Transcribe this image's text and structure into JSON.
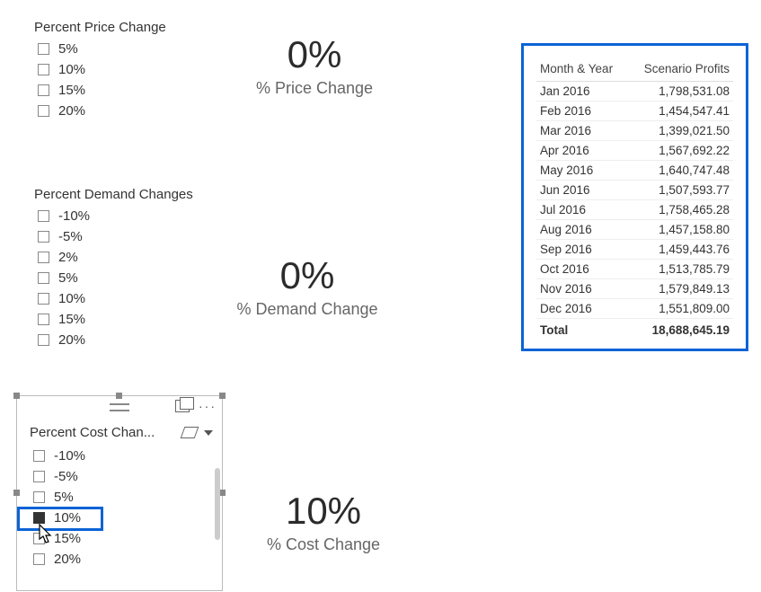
{
  "price_slicer": {
    "title": "Percent Price Change",
    "options": [
      "5%",
      "10%",
      "15%",
      "20%"
    ],
    "selected": null
  },
  "price_card": {
    "value": "0%",
    "label": "% Price Change"
  },
  "demand_slicer": {
    "title": "Percent Demand Changes",
    "options": [
      "-10%",
      "-5%",
      "2%",
      "5%",
      "10%",
      "15%",
      "20%"
    ],
    "selected": null
  },
  "demand_card": {
    "value": "0%",
    "label": "% Demand Change"
  },
  "cost_slicer": {
    "title": "Percent Cost Chan...",
    "options": [
      "-10%",
      "-5%",
      "5%",
      "10%",
      "15%",
      "20%"
    ],
    "selected": "10%"
  },
  "cost_card": {
    "value": "10%",
    "label": "% Cost Change"
  },
  "profit_table": {
    "columns": [
      "Month & Year",
      "Scenario Profits"
    ],
    "rows": [
      {
        "month": "Jan 2016",
        "profit": "1,798,531.08"
      },
      {
        "month": "Feb 2016",
        "profit": "1,454,547.41"
      },
      {
        "month": "Mar 2016",
        "profit": "1,399,021.50"
      },
      {
        "month": "Apr 2016",
        "profit": "1,567,692.22"
      },
      {
        "month": "May 2016",
        "profit": "1,640,747.48"
      },
      {
        "month": "Jun 2016",
        "profit": "1,507,593.77"
      },
      {
        "month": "Jul 2016",
        "profit": "1,758,465.28"
      },
      {
        "month": "Aug 2016",
        "profit": "1,457,158.80"
      },
      {
        "month": "Sep 2016",
        "profit": "1,459,443.76"
      },
      {
        "month": "Oct 2016",
        "profit": "1,513,785.79"
      },
      {
        "month": "Nov 2016",
        "profit": "1,579,849.13"
      },
      {
        "month": "Dec 2016",
        "profit": "1,551,809.00"
      }
    ],
    "total_label": "Total",
    "total_value": "18,688,645.19"
  }
}
